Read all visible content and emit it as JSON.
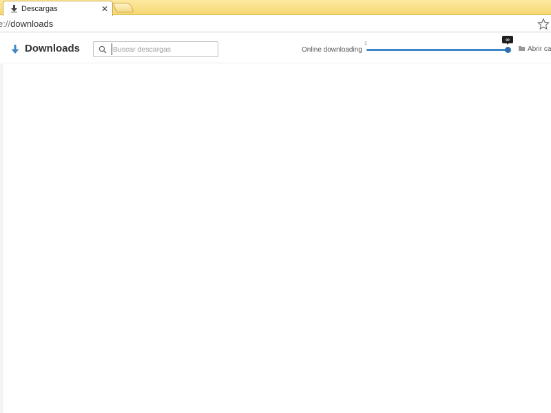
{
  "tabs": [
    {
      "title": "Descargas",
      "icon": "download-icon",
      "active": true
    }
  ],
  "omnibox": {
    "url_scheme": "e://",
    "url_rest": "downloads"
  },
  "page": {
    "title": "Downloads",
    "search": {
      "placeholder": "Buscar descargas",
      "value": ""
    },
    "online_label": "Online downloading",
    "slider": {
      "min_label": "1",
      "value_label": "∞",
      "level_percent": 100
    },
    "open_folder_label": "Abrir car"
  },
  "colors": {
    "accent": "#3d87c7",
    "tabstrip": "#f7d774"
  }
}
